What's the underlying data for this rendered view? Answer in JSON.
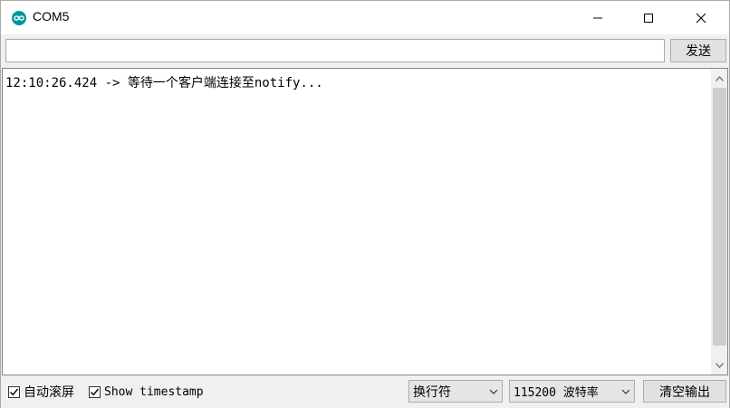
{
  "window": {
    "title": "COM5",
    "app_icon": "arduino-icon",
    "accent_color": "#00979c"
  },
  "send": {
    "input_value": "",
    "input_placeholder": "",
    "button_label": "发送"
  },
  "output": {
    "lines": [
      "12:10:26.424 -> 等待一个客户端连接至notify..."
    ]
  },
  "footer": {
    "autoscroll_label": "自动滚屏",
    "autoscroll_checked": true,
    "timestamp_label": "Show timestamp",
    "timestamp_checked": true,
    "line_ending_selected": "换行符",
    "baud_selected": "115200 波特率",
    "clear_button_label": "清空输出"
  }
}
